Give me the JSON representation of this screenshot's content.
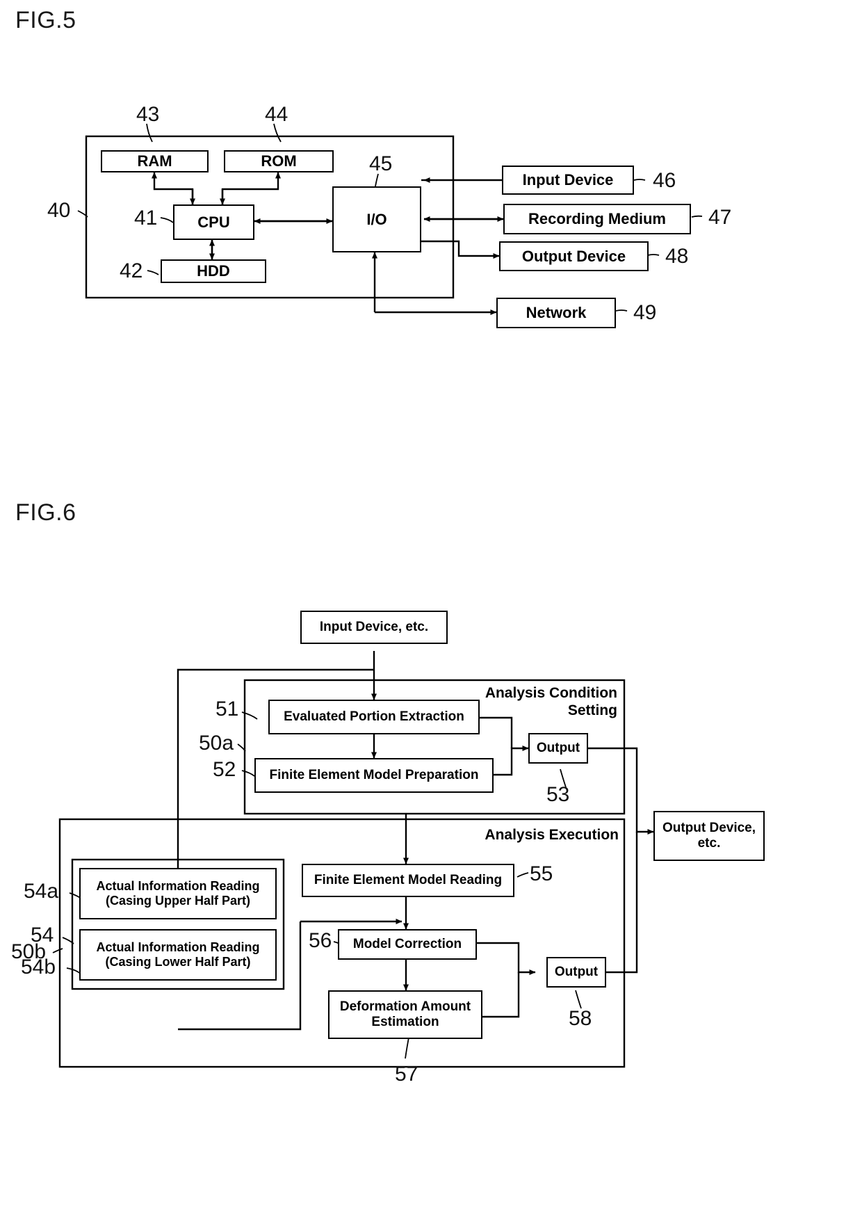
{
  "figures": [
    {
      "title": "FIG.5",
      "nodes": {
        "ram": "RAM",
        "rom": "ROM",
        "cpu": "CPU",
        "hdd": "HDD",
        "io": "I/O",
        "input_device": "Input Device",
        "recording_medium": "Recording Medium",
        "output_device": "Output Device",
        "network": "Network"
      },
      "refs": {
        "computer": "40",
        "cpu": "41",
        "hdd": "42",
        "ram": "43",
        "rom": "44",
        "io": "45",
        "input_device": "46",
        "recording_medium": "47",
        "output_device": "48",
        "network": "49"
      }
    },
    {
      "title": "FIG.6",
      "nodes": {
        "input_device_etc": "Input Device, etc.",
        "evaluated_portion_extraction": "Evaluated Portion Extraction",
        "finite_element_model_preparation": "Finite Element Model Preparation",
        "output_upper": "Output",
        "actual_info_upper": "Actual Information Reading\n(Casing Upper Half Part)",
        "actual_info_lower": "Actual Information Reading\n(Casing Lower Half Part)",
        "finite_element_model_reading": "Finite Element Model Reading",
        "model_correction": "Model Correction",
        "deformation_amount_estimation": "Deformation Amount\nEstimation",
        "output_lower": "Output",
        "output_device_etc": "Output Device,\netc."
      },
      "group_labels": {
        "analysis_condition_setting": "Analysis Condition\nSetting",
        "analysis_execution": "Analysis Execution"
      },
      "refs": {
        "analysis_condition_setting": "50a",
        "analysis_execution": "50b",
        "evaluated_portion_extraction": "51",
        "finite_element_model_preparation": "52",
        "output_upper": "53",
        "actual_info_group": "54",
        "actual_info_upper": "54a",
        "actual_info_lower": "54b",
        "finite_element_model_reading": "55",
        "model_correction": "56",
        "deformation_amount_estimation": "57",
        "output_lower": "58"
      }
    }
  ],
  "colors": {
    "line": "#000000",
    "background": "#ffffff",
    "text": "#000000"
  }
}
